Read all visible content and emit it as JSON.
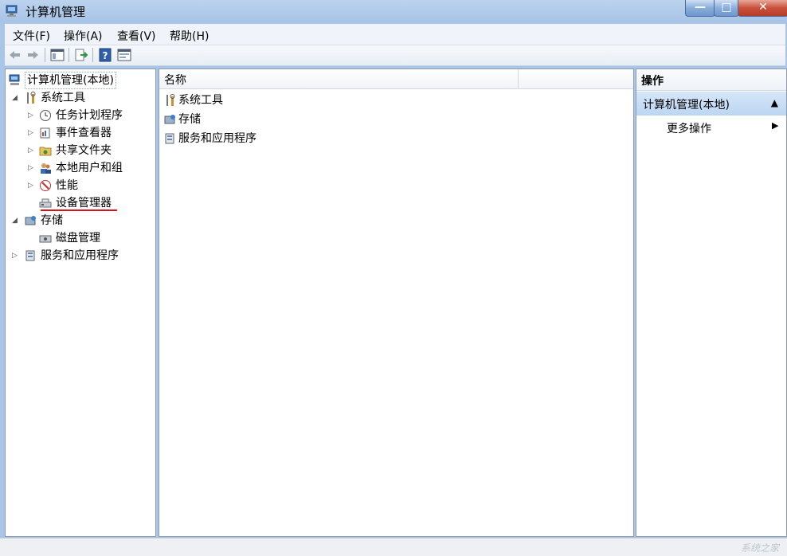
{
  "window": {
    "title": "计算机管理",
    "controls": {
      "minimize": "—",
      "maximize": "□",
      "close": "✕"
    }
  },
  "menu": [
    "文件(F)",
    "操作(A)",
    "查看(V)",
    "帮助(H)"
  ],
  "toolbar": {
    "icons": [
      "back-arrow-icon",
      "forward-arrow-icon",
      "show-hide-tree-icon",
      "export-list-icon",
      "help-icon",
      "properties-icon"
    ]
  },
  "tree": {
    "root": "计算机管理(本地)",
    "system_tools": "系统工具",
    "task_scheduler": "任务计划程序",
    "event_viewer": "事件查看器",
    "shared_folders": "共享文件夹",
    "local_users": "本地用户和组",
    "performance": "性能",
    "device_manager": "设备管理器",
    "storage": "存储",
    "disk_management": "磁盘管理",
    "services_apps": "服务和应用程序"
  },
  "list": {
    "column_name": "名称",
    "items": [
      "系统工具",
      "存储",
      "服务和应用程序"
    ]
  },
  "actions": {
    "header": "操作",
    "section": "计算机管理(本地)",
    "more": "更多操作"
  },
  "watermark": "系统之家",
  "colors": {
    "highlight_underline": "#d8141a",
    "section_bg": "#c9def5"
  }
}
